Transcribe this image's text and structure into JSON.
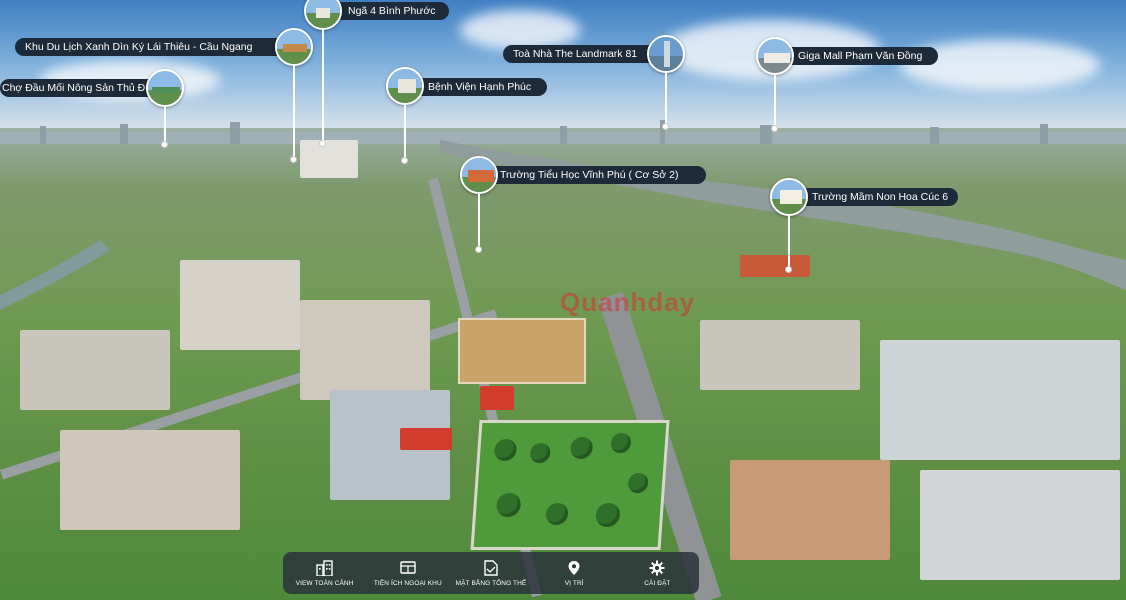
{
  "markers": [
    {
      "label": "Ngã 4 Bình Phước"
    },
    {
      "label": "Khu Du Lịch Xanh Dìn Ký Lái Thiêu - Cầu Ngang"
    },
    {
      "label": "Chợ Đầu Mối Nông Sản Thủ Đức"
    },
    {
      "label": "Bệnh Viện Hạnh Phúc"
    },
    {
      "label": "Toà Nhà The Landmark 81"
    },
    {
      "label": "Giga Mall Phạm Văn Đồng"
    },
    {
      "label": "Trường Tiểu Học Vĩnh Phú ( Cơ Sở 2)"
    },
    {
      "label": "Trường Mầm Non Hoa Cúc 6"
    }
  ],
  "watermark": "Quanhday",
  "toolbar": {
    "items": [
      {
        "label": "VIEW TOÀN CẢNH",
        "icon": "buildings-icon"
      },
      {
        "label": "TIỆN ÍCH NGOẠI KHU",
        "icon": "amenities-icon"
      },
      {
        "label": "MẶT BẰNG TỔNG THỂ",
        "icon": "floorplan-icon"
      },
      {
        "label": "VỊ TRÍ",
        "icon": "location-pin-icon"
      },
      {
        "label": "CÀI ĐẶT",
        "icon": "gear-icon"
      }
    ]
  },
  "colors": {
    "label_bg": "#1d2a3a",
    "toolbar_bg": "#28303a",
    "accent": "#ffffff"
  }
}
